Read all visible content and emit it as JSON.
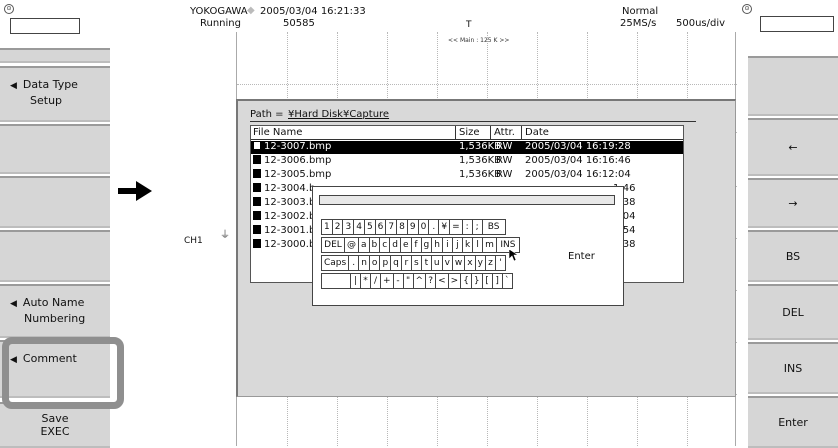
{
  "left_panel": {
    "knob": "⊙",
    "data_type": {
      "label": "Data Type",
      "value": "Setup"
    },
    "auto_name": {
      "label": "Auto Name",
      "value": "Numbering"
    },
    "comment": {
      "label": "Comment"
    },
    "save": {
      "line1": "Save",
      "line2": "EXEC"
    }
  },
  "right_panel": {
    "knob": "⊙",
    "keys": [
      "←",
      "→",
      "BS",
      "DEL",
      "INS",
      "Enter"
    ]
  },
  "status": {
    "brand": "YOKOGAWA",
    "diamond": "◆",
    "datetime": "2005/03/04 16:21:33",
    "state": "Running",
    "count": "50585",
    "trigger": "T",
    "mode": "Normal",
    "sample_rate": "25MS/s",
    "timebase": "500us/div"
  },
  "waveform": {
    "main_label": "<< Main : 125 K >>",
    "channel": "CH1",
    "ground": "⏚"
  },
  "dialog": {
    "path_label": "Path =",
    "path_value": "¥Hard Disk¥Capture",
    "columns": [
      "File Name",
      "Size",
      "Attr.",
      "Date"
    ],
    "files": [
      {
        "name": "12-3007.bmp",
        "size": "1,536KB",
        "attr": "RW",
        "date": "2005/03/04 16:19:28",
        "selected": true
      },
      {
        "name": "12-3006.bmp",
        "size": "1,536KB",
        "attr": "RW",
        "date": "2005/03/04 16:16:46"
      },
      {
        "name": "12-3005.bmp",
        "size": "1,536KB",
        "attr": "RW",
        "date": "2005/03/04 16:12:04"
      },
      {
        "name": "12-3004.b",
        "size": "",
        "attr": "",
        "date": "1:46"
      },
      {
        "name": "12-3003.b",
        "size": "",
        "attr": "",
        "date": "0:38"
      },
      {
        "name": "12-3002.b",
        "size": "",
        "attr": "",
        "date": "9:04"
      },
      {
        "name": "12-3001.b",
        "size": "",
        "attr": "",
        "date": "8:54"
      },
      {
        "name": "12-3000.b",
        "size": "",
        "attr": "",
        "date": "8:38"
      }
    ]
  },
  "keyboard": {
    "input_value": "",
    "row1": [
      "1",
      "2",
      "3",
      "4",
      "5",
      "6",
      "7",
      "8",
      "9",
      "0",
      ".",
      "¥",
      "=",
      ":",
      ";",
      "BS"
    ],
    "row2": [
      "DEL",
      "@",
      "a",
      "b",
      "c",
      "d",
      "e",
      "f",
      "g",
      "h",
      "i",
      "j",
      "k",
      "l",
      "m",
      "INS"
    ],
    "row3": [
      "Caps",
      ".",
      "n",
      "o",
      "p",
      "q",
      "r",
      "s",
      "t",
      "u",
      "v",
      "w",
      "x",
      "y",
      "z",
      "'"
    ],
    "row4": [
      "",
      "|",
      "*",
      "/",
      "+",
      "-",
      "\"",
      "^",
      "?",
      "<",
      ">",
      "{",
      "}",
      "[",
      "]",
      "`"
    ],
    "enter": "Enter"
  },
  "colors": {
    "softkey": "#d6d6d6",
    "highlight": "#8f8f8f",
    "selected_row": "#000000"
  }
}
